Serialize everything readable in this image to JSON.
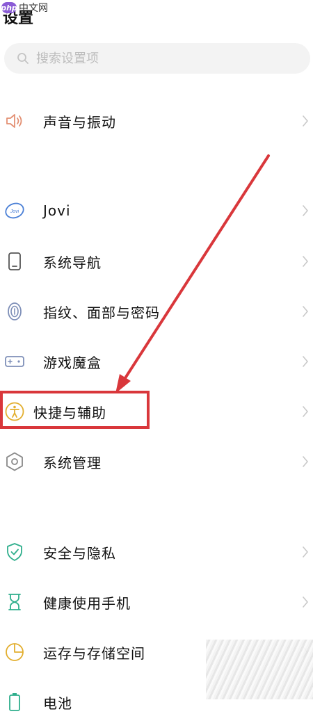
{
  "watermark": {
    "logo": "php",
    "text": "中文网"
  },
  "header": {
    "title": "设置"
  },
  "search": {
    "placeholder": "搜索设置项"
  },
  "menu": {
    "items": [
      {
        "label": "声音与振动",
        "icon": "speaker-icon",
        "color": "#e39073"
      },
      {
        "label": "Jovi",
        "icon": "jovi-icon",
        "color": "#4a7fd6"
      },
      {
        "label": "系统导航",
        "icon": "phone-icon",
        "color": "#555555"
      },
      {
        "label": "指纹、面部与密码",
        "icon": "fingerprint-icon",
        "color": "#7e8fb8"
      },
      {
        "label": "游戏魔盒",
        "icon": "gamepad-icon",
        "color": "#7e8fb8"
      },
      {
        "label": "快捷与辅助",
        "icon": "accessibility-icon",
        "color": "#e2ae2e"
      },
      {
        "label": "系统管理",
        "icon": "hexagon-icon",
        "color": "#888888"
      },
      {
        "label": "安全与隐私",
        "icon": "shield-icon",
        "color": "#2fae8c"
      },
      {
        "label": "健康使用手机",
        "icon": "hourglass-icon",
        "color": "#2fae8c"
      },
      {
        "label": "运存与存储空间",
        "icon": "storage-icon",
        "color": "#e2ae2e"
      },
      {
        "label": "电池",
        "icon": "battery-icon",
        "color": "#2fae8c"
      }
    ]
  },
  "annotation": {
    "color": "#d9373b",
    "highlighted_item": "快捷与辅助"
  }
}
